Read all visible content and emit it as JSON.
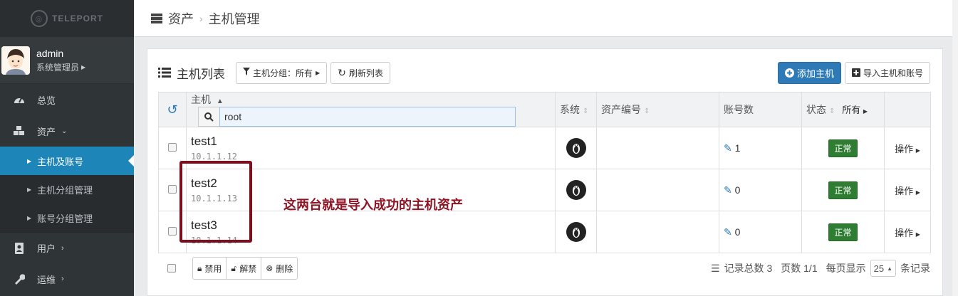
{
  "logo": {
    "text": "TELEPORT"
  },
  "user": {
    "name": "admin",
    "role": "系统管理员"
  },
  "nav": {
    "overview": "总览",
    "assets": "资产",
    "hosts_accounts": "主机及账号",
    "host_groups": "主机分组管理",
    "account_groups": "账号分组管理",
    "users": "用户",
    "ops": "运维"
  },
  "breadcrumb": {
    "root": "资产",
    "current": "主机管理"
  },
  "panel": {
    "title": "主机列表",
    "group_filter": "主机分组：所有",
    "refresh": "刷新列表",
    "add_host": "添加主机",
    "import": "导入主机和账号"
  },
  "table": {
    "headers": {
      "host": "主机",
      "system": "系统",
      "asset_no": "资产编号",
      "accounts": "账号数",
      "status": "状态",
      "status_filter": "所有"
    },
    "search_value": "root",
    "rows": [
      {
        "name": "test1",
        "ip": "10.1.1.12",
        "asset_no": "",
        "accounts": "1",
        "status": "正常",
        "action": "操作"
      },
      {
        "name": "test2",
        "ip": "10.1.1.13",
        "asset_no": "",
        "accounts": "0",
        "status": "正常",
        "action": "操作"
      },
      {
        "name": "test3",
        "ip": "10.1.1.14",
        "asset_no": "",
        "accounts": "0",
        "status": "正常",
        "action": "操作"
      }
    ]
  },
  "annotation": "这两台就是导入成功的主机资产",
  "footer": {
    "disable": "禁用",
    "enable": "解禁",
    "delete": "删除",
    "total": "记录总数 3",
    "pages": "页数 1/1",
    "per_page_label": "每页显示",
    "per_page": "25",
    "records": "条记录"
  },
  "colors": {
    "accent": "#1e85b8",
    "primary": "#2d7ab6",
    "status_ok": "#2e7d32",
    "annotation": "#8e1424"
  }
}
